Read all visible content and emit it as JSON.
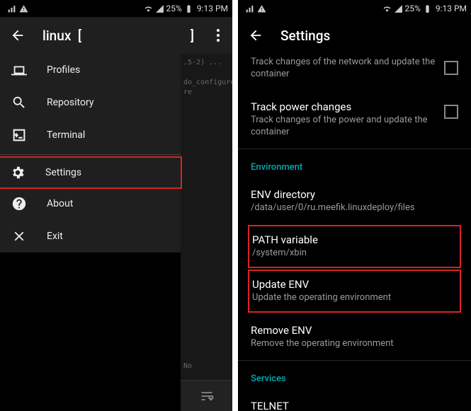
{
  "status": {
    "battery_pct": "25%",
    "time": "9:13 PM"
  },
  "left": {
    "title_prefix": "linux",
    "bracket_left": "[",
    "bracket_right": "]",
    "menu": {
      "profiles": "Profiles",
      "repository": "Repository",
      "terminal": "Terminal",
      "settings": "Settings",
      "about": "About",
      "exit": "Exit"
    },
    "term_lines": [
      ".5-2) ...",
      "do_configure",
      "re",
      "No"
    ]
  },
  "right": {
    "title": "Settings",
    "rows": {
      "net_title": "Track changes of the network and update the container",
      "power_title": "Track power changes",
      "power_sub": "Track changes of the power and update the container",
      "env_header": "Environment",
      "envdir_title": "ENV directory",
      "envdir_sub": "/data/user/0/ru.meefik.linuxdeploy/files",
      "path_title": "PATH variable",
      "path_sub": "/system/xbin",
      "update_title": "Update ENV",
      "update_sub": "Update the operating environment",
      "remove_title": "Remove ENV",
      "remove_sub": "Remove the operating environment",
      "services_header": "Services",
      "telnet_title": "TELNET"
    }
  }
}
